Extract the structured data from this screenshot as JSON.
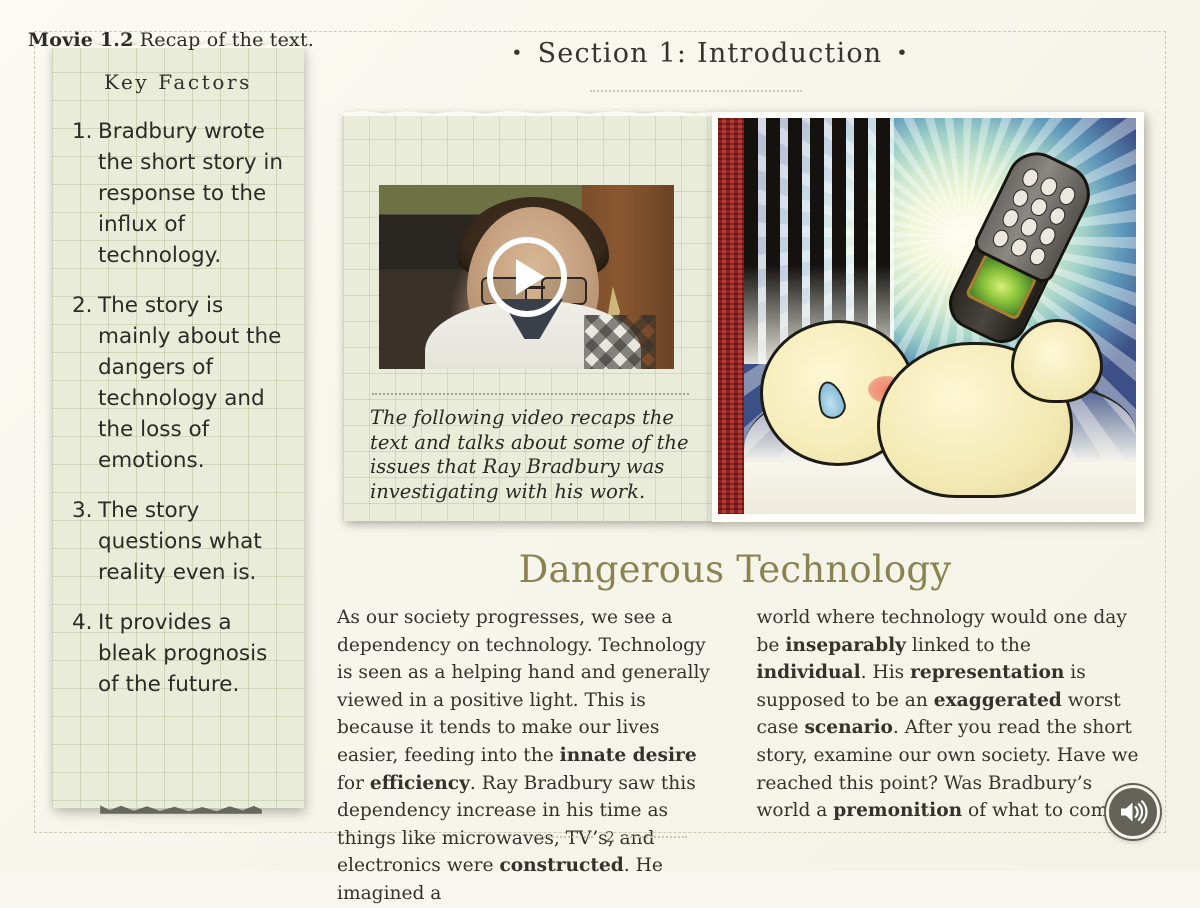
{
  "header": {
    "bullet": "•",
    "section_title": "Section 1: Introduction"
  },
  "sidebar": {
    "heading": "Key Factors",
    "factors": [
      {
        "num": "1.",
        "text": "Bradbury wrote the short story in response to the influx of technology."
      },
      {
        "num": "2.",
        "text": "The story is mainly about the dangers of technology and the loss of emotions."
      },
      {
        "num": "3.",
        "text": "The story questions what reality even is."
      },
      {
        "num": "4.",
        "text": "It provides a bleak prognosis of the future."
      }
    ]
  },
  "movie": {
    "label_bold": "Movie 1.2",
    "label_rest": " Recap of the text.",
    "play_icon": "play-triangle-icon",
    "caption": "The following video recaps the text and talks about some of the issues that Ray Bradbury was investigating with his work."
  },
  "illustration": {
    "alt": "Cartoon of a baby being fed from a mobile phone instead of a bottle"
  },
  "article": {
    "title": "Dangerous Technology",
    "columns": [
      [
        {
          "t": "As our society progresses, we see a dependency on technology.  Technology is seen as a helping hand and generally viewed in a positive light.  This is because it tends to make our lives easier, feeding into the "
        },
        {
          "t": "innate desire",
          "b": true
        },
        {
          "t": " for "
        },
        {
          "t": "efficiency",
          "b": true
        },
        {
          "t": ".  Ray Bradbury saw this dependency increase in his time as things like microwaves, TV’s, and electronics were "
        },
        {
          "t": "constructed",
          "b": true
        },
        {
          "t": ".  He imagined a"
        }
      ],
      [
        {
          "t": "world where technology would one day be "
        },
        {
          "t": "inseparably",
          "b": true
        },
        {
          "t": " linked to the "
        },
        {
          "t": "individual",
          "b": true
        },
        {
          "t": ".  His "
        },
        {
          "t": "representation",
          "b": true
        },
        {
          "t": " is supposed to be an "
        },
        {
          "t": "exaggerated",
          "b": true
        },
        {
          "t": " worst case "
        },
        {
          "t": "scenario",
          "b": true
        },
        {
          "t": ".  After you read the short story, examine our own society.  Have we reached this point?  Was Bradbury’s world a "
        },
        {
          "t": "premonition",
          "b": true
        },
        {
          "t": " of what to come?"
        }
      ]
    ]
  },
  "footer": {
    "page_number": "2",
    "audio_icon": "speaker-volume-icon"
  },
  "colors": {
    "page_background": "#f7f7ef",
    "notepad": "#e9ecd9",
    "title_accent": "#8a8351",
    "body_text": "#33332c",
    "audio_button": "#63635a",
    "cartoon_stripe": "#8e2020"
  }
}
